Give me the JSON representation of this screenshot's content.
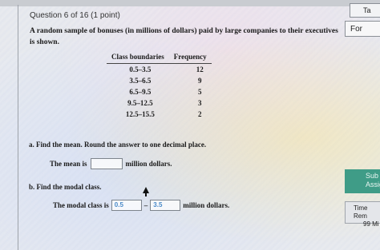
{
  "question": {
    "header": "Question 6 of 16 (1 point)",
    "prompt": "A random sample of bonuses (in millions of dollars) paid by large companies to their executives is shown."
  },
  "table": {
    "headers": [
      "Class boundaries",
      "Frequency"
    ],
    "rows": [
      {
        "class": "0.5–3.5",
        "freq": "12"
      },
      {
        "class": "3.5–6.5",
        "freq": "9"
      },
      {
        "class": "6.5–9.5",
        "freq": "5"
      },
      {
        "class": "9.5–12.5",
        "freq": "3"
      },
      {
        "class": "12.5–15.5",
        "freq": "2"
      }
    ]
  },
  "part_a": {
    "label": "a. Find the mean. Round the answer to one decimal place.",
    "prefix": "The mean is",
    "value": "",
    "suffix": "million dollars."
  },
  "part_b": {
    "label": "b. Find the modal class.",
    "prefix": "The modal class is",
    "low_value": "0.5",
    "separator": "–",
    "high_value": "3.5",
    "suffix": "million dollars."
  },
  "side": {
    "tab_label": "Ta",
    "button_label": "For",
    "submit_label_line1": "Sub",
    "submit_label_line2": "Assign",
    "time_line1": "Time Rem",
    "time_line2": "99 Mi"
  },
  "colors": {
    "submit_bg": "#3f9c87",
    "input_text": "#4a8ac8"
  }
}
